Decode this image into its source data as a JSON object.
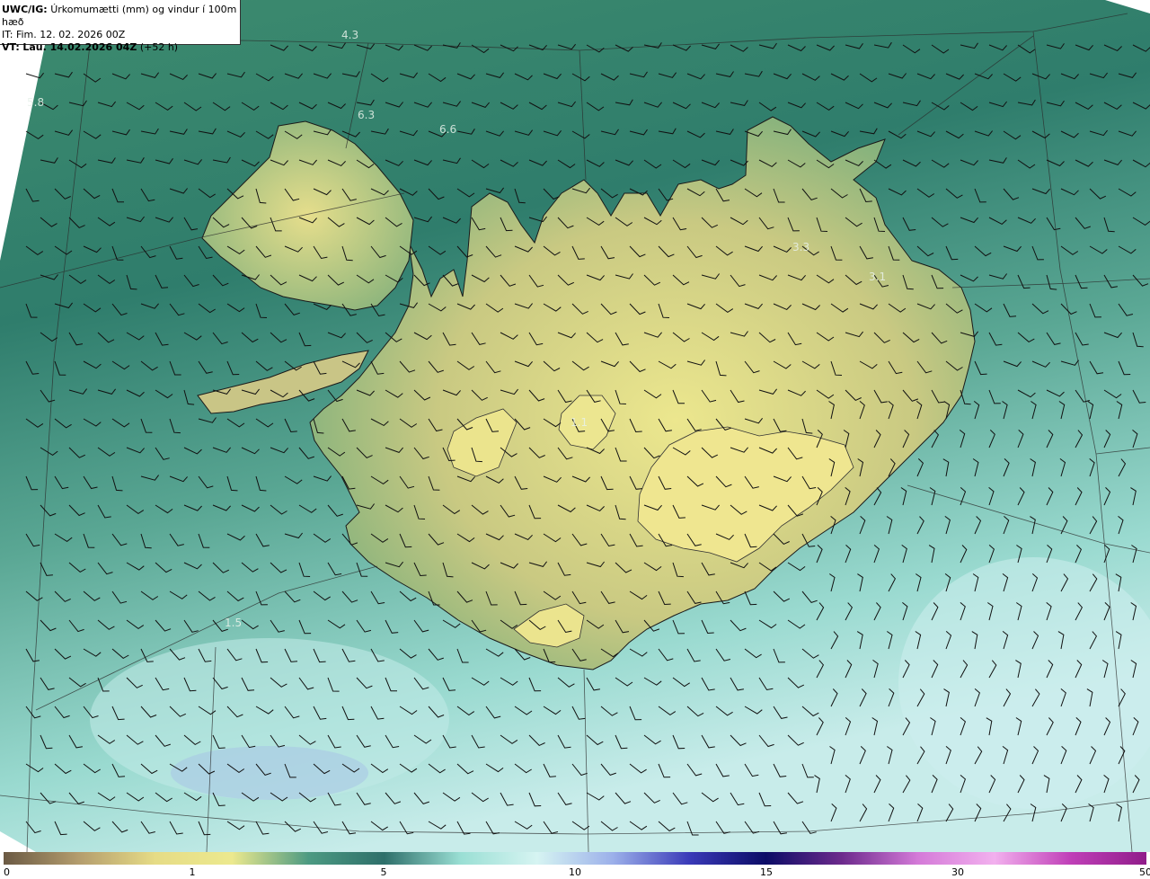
{
  "header": {
    "model": "UWC/IG:",
    "title": "Úrkomumætti (mm) og vindur í 100m hæð",
    "it_label": "IT:",
    "it_value": "Fim. 12. 02. 2026 00Z",
    "vt_label": "VT:",
    "vt_value": "Lau. 14.02.2026 04Z",
    "vt_offset": "(+52 h)"
  },
  "colorbar": {
    "ticks": [
      "0",
      "1",
      "5",
      "10",
      "15",
      "30",
      "50"
    ],
    "stops": [
      "#6b5a44",
      "#b59e6e",
      "#e6dc86",
      "#ece98e",
      "#4c9a82",
      "#2e6f6a",
      "#9adfd4",
      "#d6f4f2",
      "#9cb0ea",
      "#3a3ab8",
      "#0c0c66",
      "#6c2a8c",
      "#d47ad8",
      "#f2b0ee",
      "#c040b8",
      "#901c8a"
    ]
  },
  "map_labels": [
    {
      "id": "label-4-3",
      "text": "4.3"
    },
    {
      "id": "label-5-8",
      "text": "5.8"
    },
    {
      "id": "label-6-3",
      "text": "6.3"
    },
    {
      "id": "label-6-6",
      "text": "6.6"
    },
    {
      "id": "label-3-3",
      "text": "3.3"
    },
    {
      "id": "label-3-1",
      "text": "3.1"
    },
    {
      "id": "label-1-1",
      "text": "1.1"
    },
    {
      "id": "label-1-5",
      "text": "1.5"
    }
  ],
  "colors": {
    "land_low": "#d7d488",
    "land_high": "#e9e48e",
    "sea_north": "#3b8a72",
    "sea_south": "#9edcd0",
    "coast": "#1a1a1a"
  }
}
